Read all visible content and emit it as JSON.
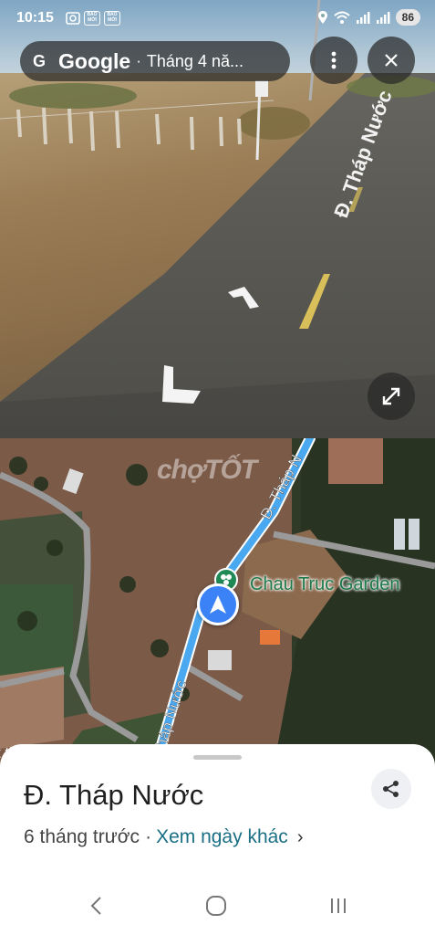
{
  "status_bar": {
    "time": "10:15",
    "badge_1": "BÁO MỚI",
    "badge_2": "BÁO MỚI",
    "battery": "86"
  },
  "street_view": {
    "brand": "Google",
    "date_label": "Tháng 4 nă...",
    "road_marking": "Đ. Tháp Nước"
  },
  "map": {
    "watermark": "chợTỐT",
    "road_label_top": "Đ. Tháp N",
    "road_label_bottom": "Tháp Nước",
    "place_name": "Chau Truc Garden",
    "edge_text": "t th"
  },
  "sheet": {
    "title": "Đ. Tháp Nước",
    "age": "6 tháng trước",
    "separator": "·",
    "other_dates_link": "Xem ngày khác",
    "chevron": "›"
  },
  "icons": {
    "menu": "more-vert-icon",
    "close": "close-icon",
    "expand": "expand-icon",
    "share": "share-icon",
    "location": "navigation-arrow-icon"
  },
  "colors": {
    "route_blue": "#4aa8f0",
    "place_green": "#1f7a4a",
    "link_teal": "#1a6f85"
  }
}
